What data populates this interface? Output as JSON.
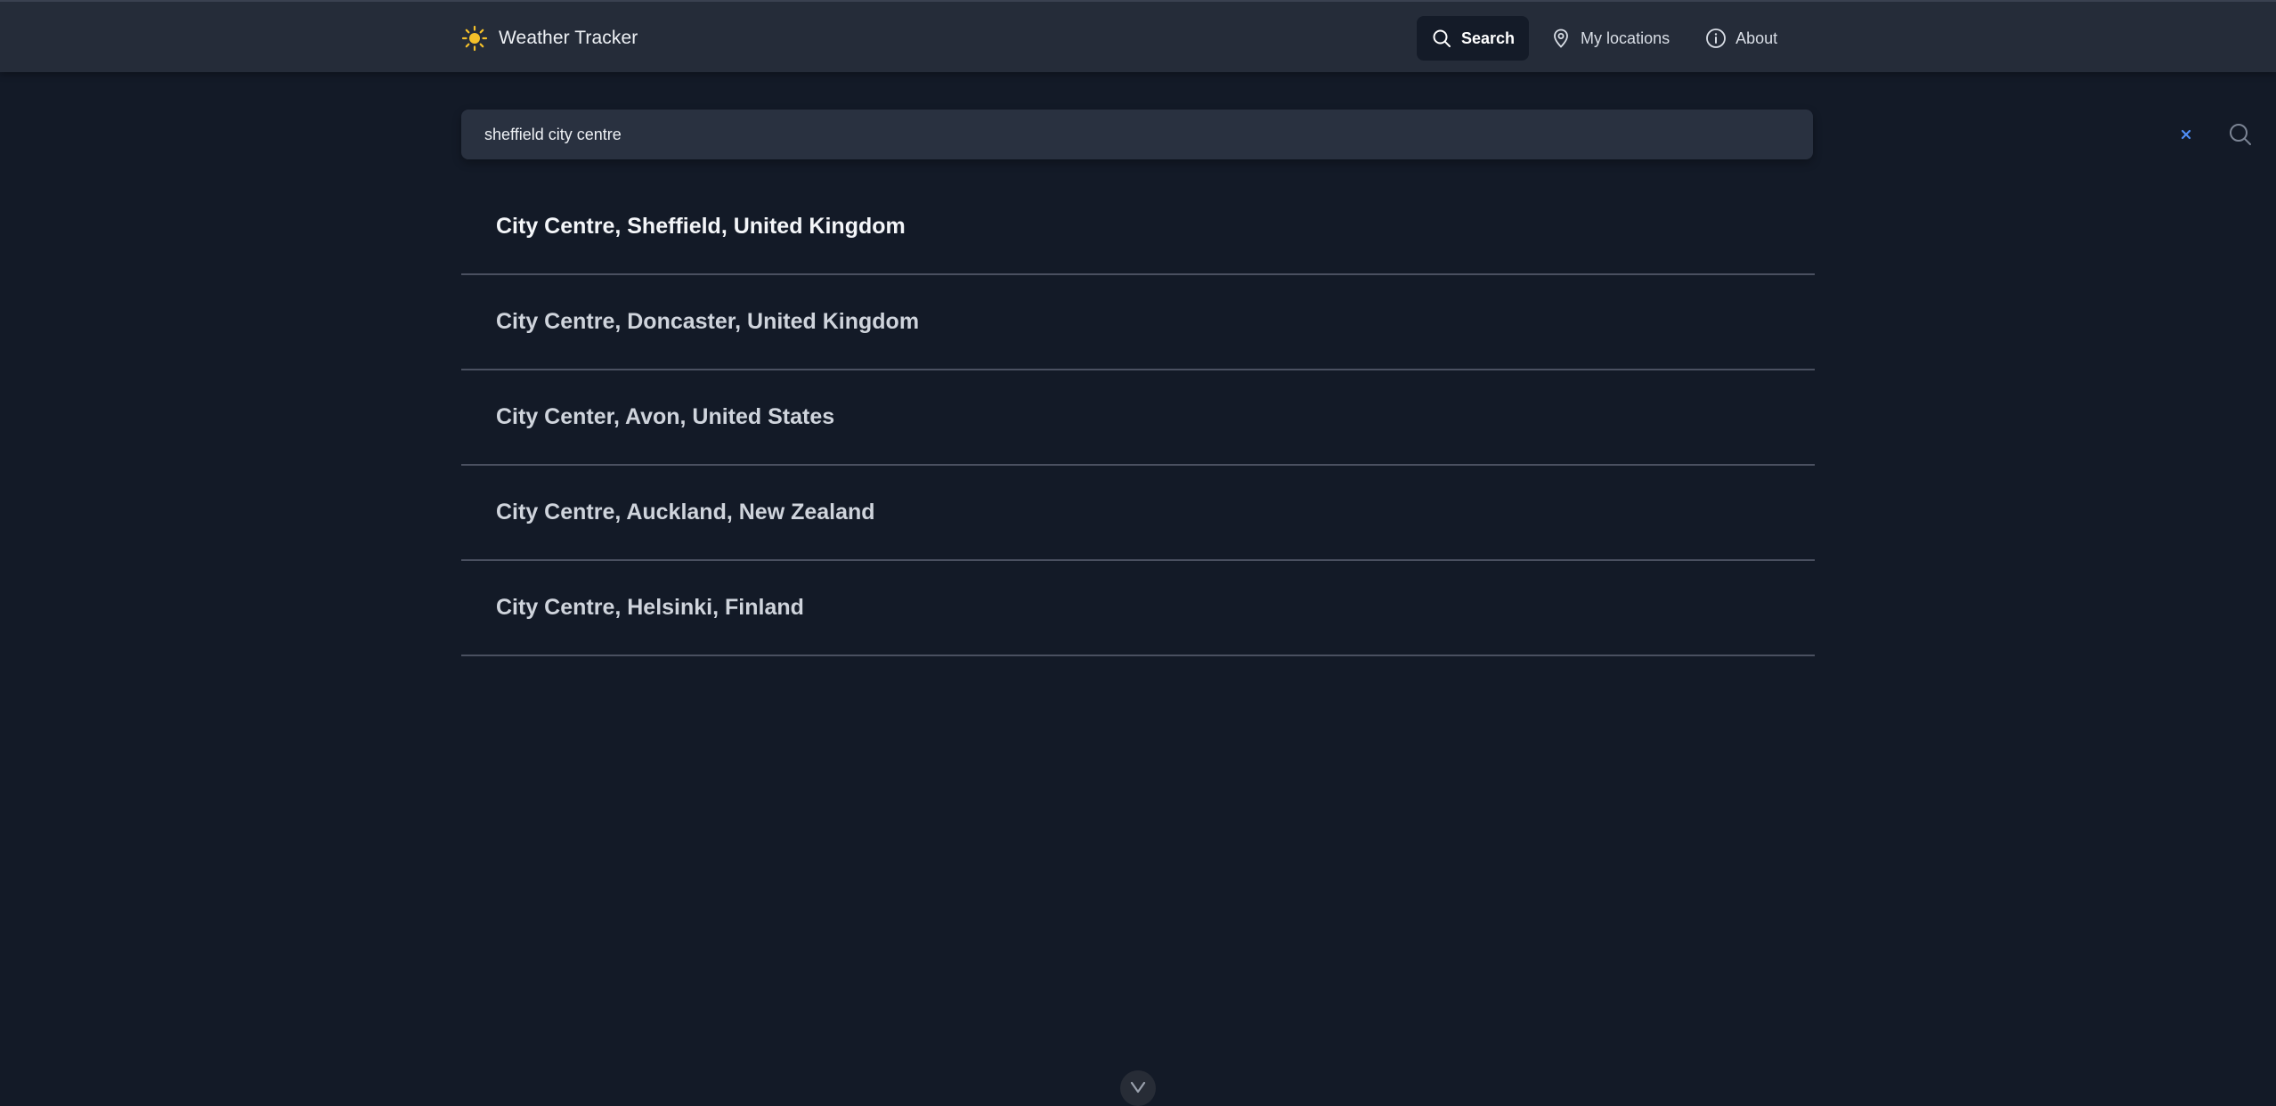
{
  "colors": {
    "background": "#131a27",
    "header": "#252c39",
    "search_bar": "#293140",
    "accent_sun": "#f4c02a",
    "clear_accent": "#4f8ef7",
    "active_nav": "#141b28"
  },
  "header": {
    "brand_icon": "sun-icon",
    "title": "Weather Tracker"
  },
  "nav": [
    {
      "label": "Search",
      "icon": "search-icon",
      "active": true
    },
    {
      "label": "My locations",
      "icon": "location-pin-icon",
      "active": false
    },
    {
      "label": "About",
      "icon": "info-icon",
      "active": false
    }
  ],
  "search": {
    "value": "sheffield city centre",
    "placeholder": "",
    "clear_icon": "close-icon",
    "submit_icon": "search-icon"
  },
  "results": [
    {
      "label": "City Centre, Sheffield, United Kingdom"
    },
    {
      "label": "City Centre, Doncaster, United Kingdom"
    },
    {
      "label": "City Center, Avon, United States"
    },
    {
      "label": "City Centre, Auckland, New Zealand"
    },
    {
      "label": "City Centre, Helsinki, Finland"
    }
  ],
  "footer": {
    "scroll_icon": "chevron-down-icon"
  }
}
